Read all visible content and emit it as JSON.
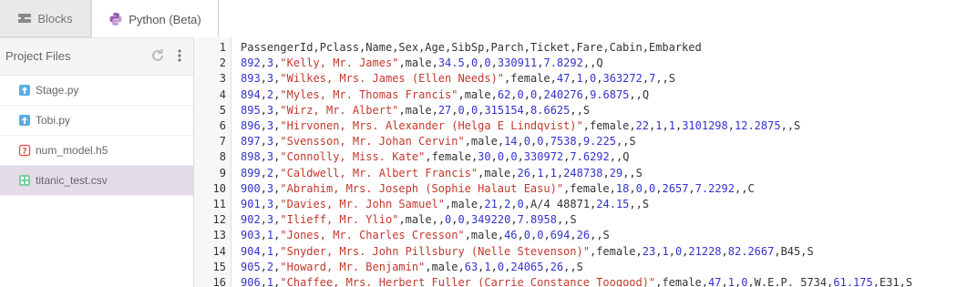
{
  "tabs": [
    {
      "label": "Blocks",
      "icon": "blocks-icon"
    },
    {
      "label": "Python (Beta)",
      "icon": "python-icon"
    }
  ],
  "sidebar": {
    "title": "Project Files",
    "files": [
      {
        "name": "Stage.py",
        "icon": "python-file-icon"
      },
      {
        "name": "Tobi.py",
        "icon": "python-file-icon"
      },
      {
        "name": "num_model.h5",
        "icon": "unknown-file-icon"
      },
      {
        "name": "titanic_test.csv",
        "icon": "csv-file-icon",
        "selected": true
      }
    ]
  },
  "editor": {
    "lines": [
      "PassengerId,Pclass,Name,Sex,Age,SibSp,Parch,Ticket,Fare,Cabin,Embarked",
      "892,3,\"Kelly, Mr. James\",male,34.5,0,0,330911,7.8292,,Q",
      "893,3,\"Wilkes, Mrs. James (Ellen Needs)\",female,47,1,0,363272,7,,S",
      "894,2,\"Myles, Mr. Thomas Francis\",male,62,0,0,240276,9.6875,,Q",
      "895,3,\"Wirz, Mr. Albert\",male,27,0,0,315154,8.6625,,S",
      "896,3,\"Hirvonen, Mrs. Alexander (Helga E Lindqvist)\",female,22,1,1,3101298,12.2875,,S",
      "897,3,\"Svensson, Mr. Johan Cervin\",male,14,0,0,7538,9.225,,S",
      "898,3,\"Connolly, Miss. Kate\",female,30,0,0,330972,7.6292,,Q",
      "899,2,\"Caldwell, Mr. Albert Francis\",male,26,1,1,248738,29,,S",
      "900,3,\"Abrahim, Mrs. Joseph (Sophie Halaut Easu)\",female,18,0,0,2657,7.2292,,C",
      "901,3,\"Davies, Mr. John Samuel\",male,21,2,0,A/4 48871,24.15,,S",
      "902,3,\"Ilieff, Mr. Ylio\",male,,0,0,349220,7.8958,,S",
      "903,1,\"Jones, Mr. Charles Cresson\",male,46,0,0,694,26,,S",
      "904,1,\"Snyder, Mrs. John Pillsbury (Nelle Stevenson)\",female,23,1,0,21228,82.2667,B45,S",
      "905,2,\"Howard, Mr. Benjamin\",male,63,1,0,24065,26,,S",
      "906,1,\"Chaffee, Mrs. Herbert Fuller (Carrie Constance Toogood)\",female,47,1,0,W.E.P. 5734,61.175,E31,S"
    ]
  },
  "colors": {
    "number": "#3333cc",
    "string": "#c0392b",
    "text": "#333333",
    "selected_file_bg": "#e4dbe8"
  }
}
